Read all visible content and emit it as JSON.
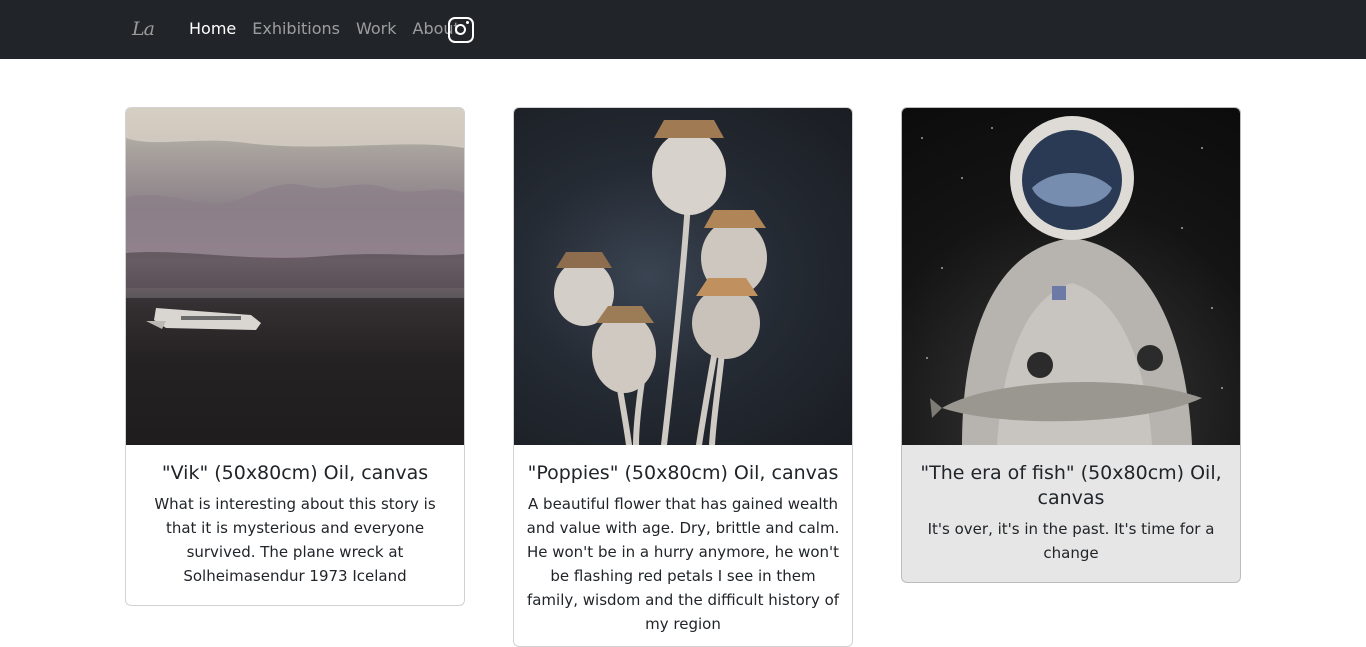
{
  "navbar": {
    "brand": "La",
    "links": [
      {
        "label": "Home",
        "active": true
      },
      {
        "label": "Exhibitions",
        "active": false
      },
      {
        "label": "Work",
        "active": false
      },
      {
        "label": "About",
        "active": false
      }
    ],
    "social_icon": "instagram-icon"
  },
  "cards": [
    {
      "title": "\"Vik\" (50x80cm) Oil, canvas",
      "text": "What is interesting about this story is that it is mysterious and everyone survived. The plane wreck at Solheimasendur 1973 Iceland"
    },
    {
      "title": "\"Poppies\" (50x80cm) Oil, canvas",
      "text": "A beautiful flower that has gained wealth and value with age. Dry, brittle and calm. He won't be in a hurry anymore, he won't be flashing red petals I see in them family, wisdom and the difficult history of my region"
    },
    {
      "title": "\"The era of fish\" (50x80cm) Oil, canvas",
      "text": "It's over, it's in the past. It's time for a change"
    }
  ],
  "colors": {
    "navbar_bg": "#212529",
    "nav_active": "#ffffff",
    "nav_inactive": "rgba(255,255,255,0.55)",
    "card_highlight_bg": "#e6e6e6"
  }
}
